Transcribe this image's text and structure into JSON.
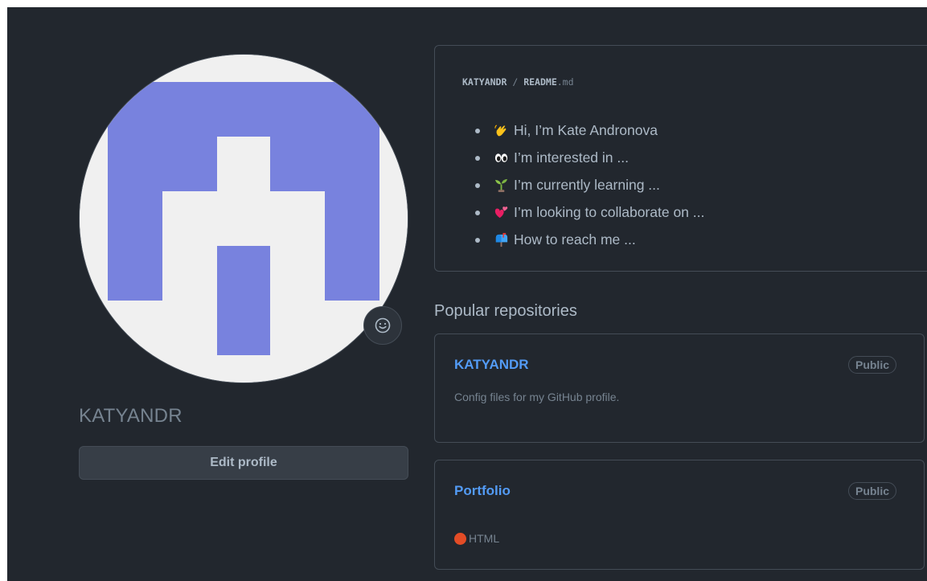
{
  "profile": {
    "username": "KATYANDR",
    "edit_button": "Edit profile",
    "avatar_colors": {
      "primary": "#7882de",
      "background": "#f0f0f0"
    }
  },
  "readme": {
    "owner": "KATYANDR",
    "separator": "/",
    "file_name": "README",
    "file_ext": ".md",
    "items": [
      {
        "icon": "waving-hand-icon",
        "text": "Hi, I’m Kate Andronova"
      },
      {
        "icon": "eyes-icon",
        "text": "I’m interested in ..."
      },
      {
        "icon": "seedling-icon",
        "text": "I’m currently learning ..."
      },
      {
        "icon": "revolving-hearts-icon",
        "text": "I’m looking to collaborate on ..."
      },
      {
        "icon": "mailbox-icon",
        "text": "How to reach me ..."
      }
    ]
  },
  "popular": {
    "title": "Popular repositories",
    "repos": [
      {
        "name": "KATYANDR",
        "visibility": "Public",
        "description": "Config files for my GitHub profile."
      },
      {
        "name": "Portfolio",
        "visibility": "Public",
        "language": "HTML",
        "language_color": "#e34c26"
      }
    ]
  }
}
